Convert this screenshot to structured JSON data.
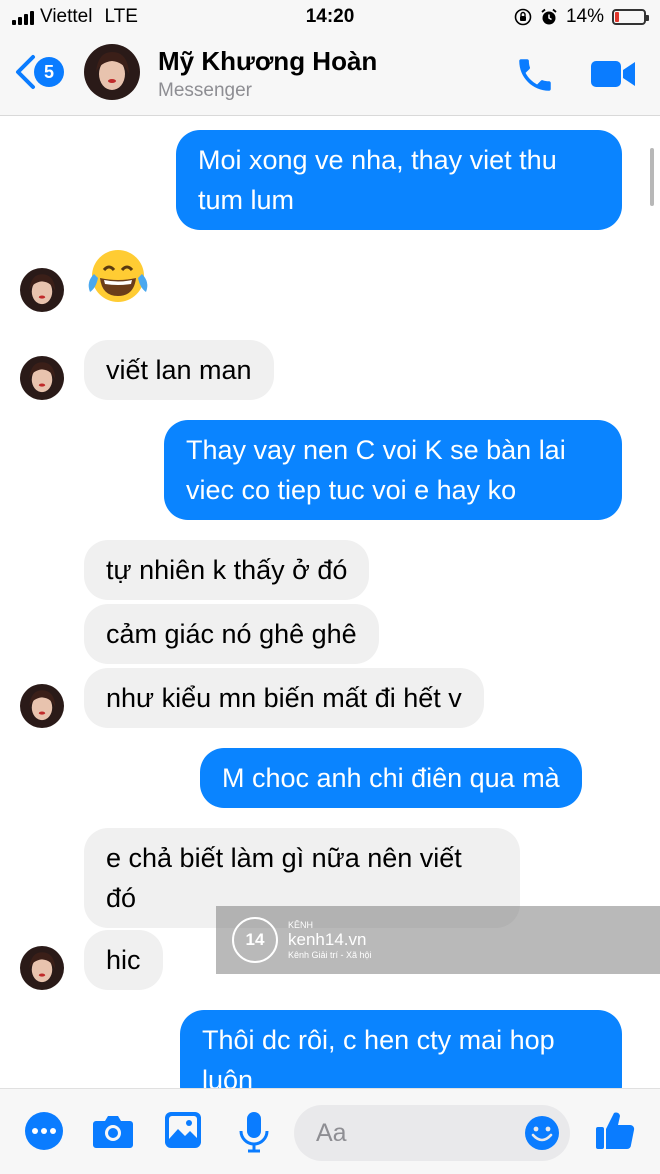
{
  "status_bar": {
    "carrier": "Viettel",
    "network": "LTE",
    "time": "14:20",
    "battery": "14%",
    "battery_level": 0.14
  },
  "header": {
    "back_count": "5",
    "contact_name": "Mỹ Khương Hoàn",
    "subtitle": "Messenger"
  },
  "messages": [
    {
      "dir": "out",
      "text": "Moi xong ve nha, thay viet thu\ntum lum"
    },
    {
      "dir": "in",
      "type": "emoji",
      "icon": "face-with-tears-of-joy-emoji"
    },
    {
      "dir": "in",
      "text": "viết lan man"
    },
    {
      "dir": "out",
      "text": "Thay vay nen C voi K se bàn lai\nviec co tiep tuc voi e hay ko"
    },
    {
      "dir": "in",
      "text": "tự nhiên k thấy ở đó"
    },
    {
      "dir": "in",
      "text": "cảm giác nó ghê ghê"
    },
    {
      "dir": "in",
      "text": "như kiểu mn biến mất đi hết v"
    },
    {
      "dir": "out",
      "text": "M choc anh chi điên qua mà"
    },
    {
      "dir": "in",
      "text": "e chả biết làm gì nữa nên viết\nđó"
    },
    {
      "dir": "in",
      "text": "hic"
    },
    {
      "dir": "out",
      "text": "Thôi dc rôi, c hen cty mai hop\nluôn"
    }
  ],
  "watermark": {
    "logo": "14",
    "brand_small": "KÊNH",
    "name": "kenh14.vn",
    "tagline": "Kênh Giải trí - Xã hội"
  },
  "composer": {
    "placeholder": "Aa"
  },
  "colors": {
    "accent": "#0a84ff",
    "incoming": "#f0f0f0",
    "battery_low": "#e0362b"
  }
}
